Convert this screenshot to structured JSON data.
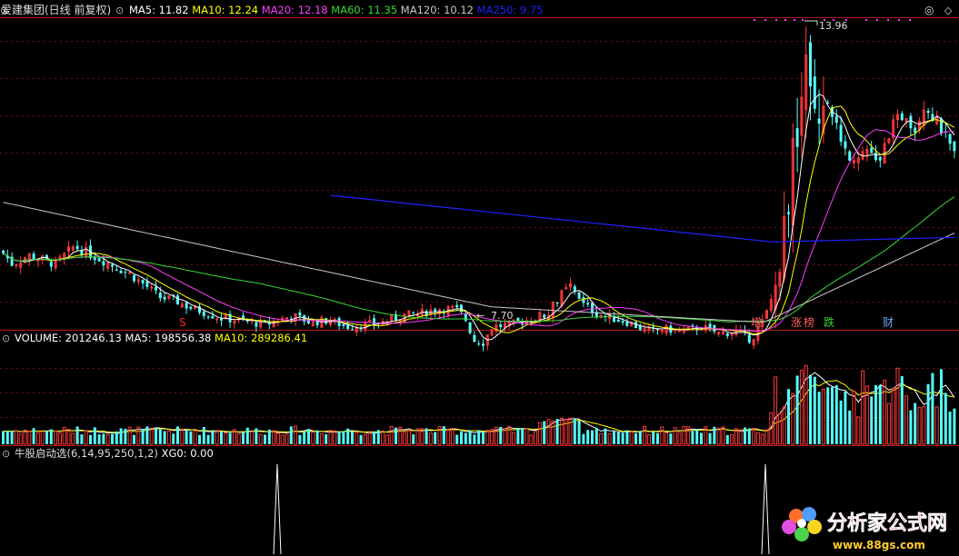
{
  "colors": {
    "background": "#000000",
    "divider": "#b01818",
    "up": "#ff3a3a",
    "down": "#54fcfc",
    "ma5": "#ffffff",
    "ma10": "#ffff00",
    "ma20": "#ff3cff",
    "ma60": "#36d836",
    "ma120": "#c8c8c8",
    "ma250": "#2020ff"
  },
  "price_panel": {
    "title": "爱建集团(日线 前复权)",
    "indicators": [
      {
        "label": "MA5: 11.82",
        "color": "#ffffff"
      },
      {
        "label": "MA10: 12.24",
        "color": "#ffff00"
      },
      {
        "label": "MA20: 12.18",
        "color": "#ff3cff"
      },
      {
        "label": "MA60: 11.35",
        "color": "#36d836"
      },
      {
        "label": "MA120: 10.12",
        "color": "#c8c8c8"
      },
      {
        "label": "MA250: 9.75",
        "color": "#2020ff"
      }
    ],
    "high_marker": "13.96",
    "low_marker": "7.70",
    "event_tags": [
      {
        "text": "S",
        "color": "#ff2020"
      },
      {
        "text": "增",
        "color": "#ff6060"
      },
      {
        "text": "涨",
        "color": "#ff6060"
      },
      {
        "text": "榜",
        "color": "#ff6060"
      },
      {
        "text": "跌",
        "color": "#36d836"
      },
      {
        "text": "财",
        "color": "#6fa8ff"
      }
    ]
  },
  "volume_panel": {
    "indicators": [
      {
        "label": "VOLUME: 201246.13",
        "color": "#ffffff"
      },
      {
        "label": "MA5: 198556.38",
        "color": "#ffffff"
      },
      {
        "label": "MA10: 289286.41",
        "color": "#ffff00"
      }
    ]
  },
  "signal_panel": {
    "indicators": [
      {
        "label": "牛股启动选(6,14,95,250,1,2)",
        "color": "#dddddd"
      },
      {
        "label": "XG0: 0.00",
        "color": "#ffffff"
      }
    ]
  },
  "watermark": {
    "main": "分析家公式网",
    "url": "www.88gs.com"
  },
  "chart_data": {
    "type": "candlestick",
    "security": "爱建集团",
    "period": "日线 前复权",
    "price_high": 13.96,
    "price_low": 7.7,
    "ma_latest": {
      "MA5": 11.82,
      "MA10": 12.24,
      "MA20": 12.18,
      "MA60": 11.35,
      "MA120": 10.12,
      "MA250": 9.75
    },
    "volume_latest": {
      "VOLUME": 201246.13,
      "MA5": 198556.38,
      "MA10": 289286.41
    },
    "signal": {
      "name": "牛股启动选",
      "params": [
        6,
        14,
        95,
        250,
        1,
        2
      ],
      "XG0": 0.0
    }
  }
}
